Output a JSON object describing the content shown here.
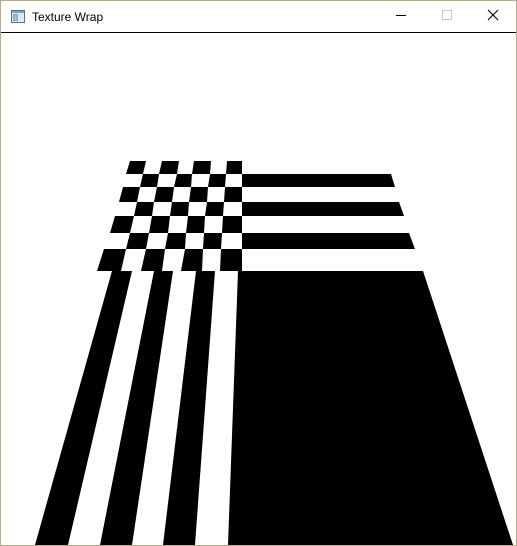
{
  "window": {
    "title": "Texture Wrap",
    "app_icon": "window-app-icon",
    "controls": {
      "minimize_icon": "minimize-icon",
      "maximize_icon": "maximize-icon",
      "close_icon": "close-icon"
    }
  },
  "scene": {
    "description_colors": {
      "background": "#ffffff",
      "pattern_dark": "#000000",
      "pattern_light": "#ffffff"
    }
  }
}
